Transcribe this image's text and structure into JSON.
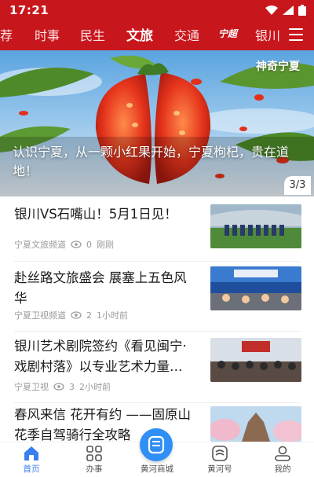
{
  "status": {
    "time": "17:21"
  },
  "channels": [
    {
      "label": "荐",
      "active": false
    },
    {
      "label": "时事",
      "active": false
    },
    {
      "label": "民生",
      "active": false
    },
    {
      "label": "文旅",
      "active": true
    },
    {
      "label": "交通",
      "active": false
    },
    {
      "label": "宁超",
      "active": false
    },
    {
      "label": "银川",
      "active": false
    }
  ],
  "banner": {
    "channel_label": "神奇宁夏",
    "caption": "认识宁夏，从一颗小红果开始，宁夏枸杞，贵在道地！",
    "page_indicator": "3/3"
  },
  "news": [
    {
      "title": "银川VS石嘴山！5月1日见！",
      "source": "宁夏文旅频道",
      "views": "0",
      "time": "刚刚"
    },
    {
      "title": "赴丝路文旅盛会 展塞上五色风华",
      "source": "宁夏卫视频道",
      "views": "2",
      "time": "1小时前"
    },
    {
      "title": "银川艺术剧院签约《看见闽宁·戏剧村落》以专业艺术力量…",
      "source": "宁夏卫视",
      "views": "3",
      "time": "2小时前"
    },
    {
      "title": "春风来信 花开有约 ——固原山花季自驾骑行全攻略",
      "source": "",
      "views": "",
      "time": ""
    }
  ],
  "bottom_nav": [
    {
      "label": "首页",
      "icon": "home-icon",
      "active": true
    },
    {
      "label": "办事",
      "icon": "grid-icon",
      "active": false
    },
    {
      "label": "黄河商城",
      "icon": "mall-icon",
      "active": false
    },
    {
      "label": "黄河号",
      "icon": "channel-icon",
      "active": false
    },
    {
      "label": "我的",
      "icon": "profile-icon",
      "active": false
    }
  ],
  "colors": {
    "brand_red": "#c8161d",
    "accent_blue": "#3a7ff0"
  }
}
